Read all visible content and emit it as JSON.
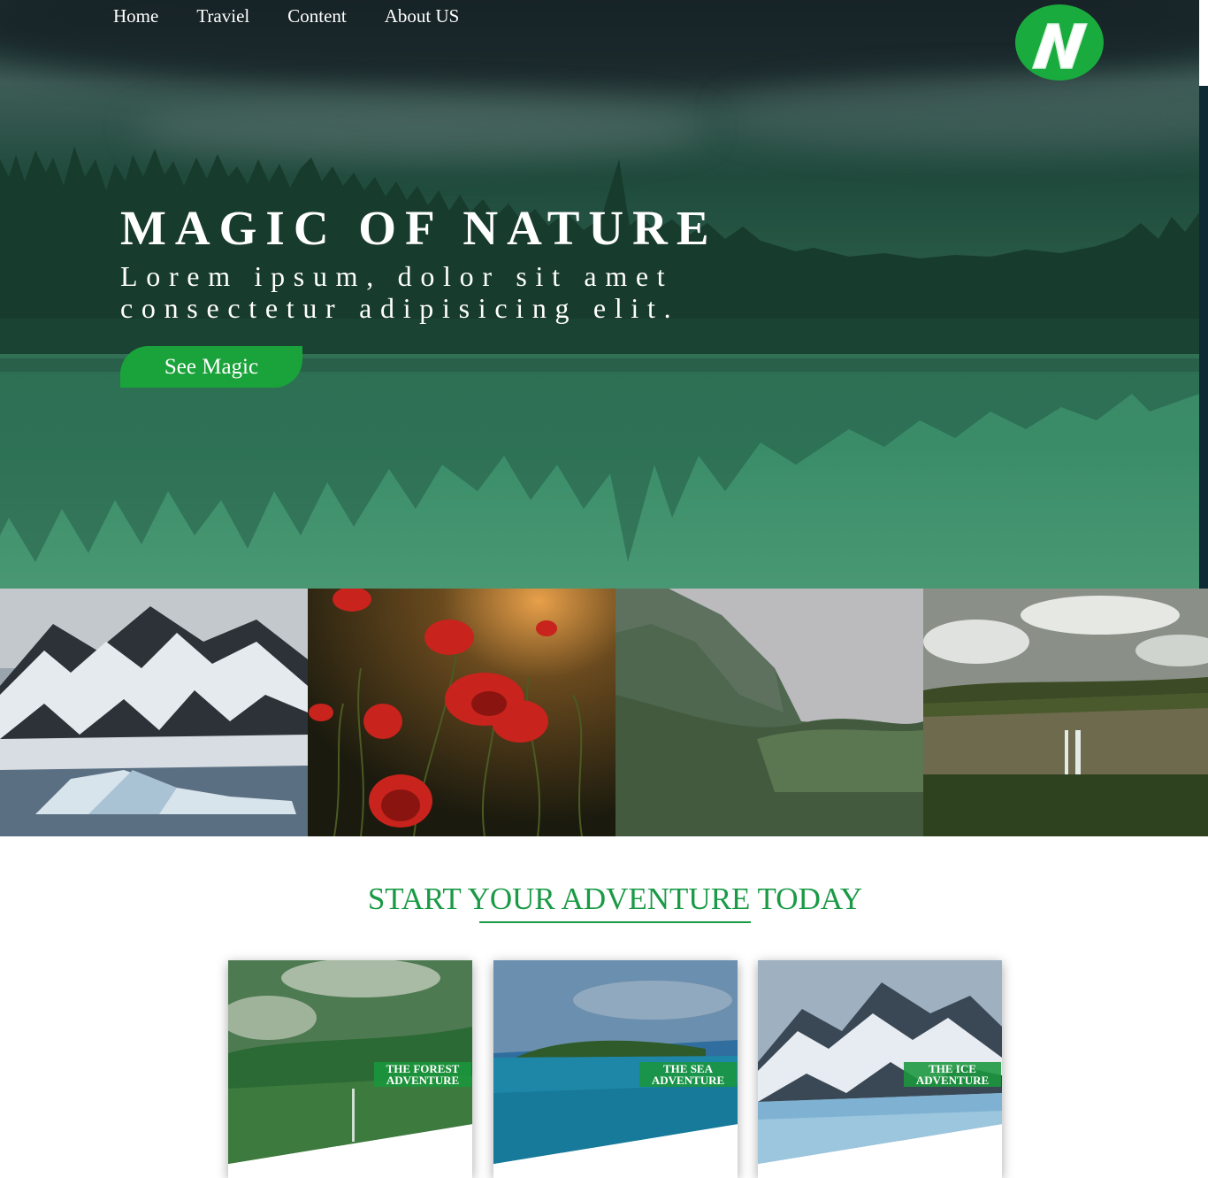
{
  "nav": {
    "items": [
      {
        "label": "Home"
      },
      {
        "label": "Traviel"
      },
      {
        "label": "Content"
      },
      {
        "label": "About US"
      }
    ],
    "logo_letter": "N"
  },
  "hero": {
    "title": "MAGIC OF NATURE",
    "subtitle_line1": "Lorem ipsum, dolor sit amet",
    "subtitle_line2": "consectetur adipisicing elit.",
    "cta_label": "See Magic"
  },
  "gallery": {
    "items": [
      {
        "icon": "snowy-mountains-image"
      },
      {
        "icon": "red-poppies-image"
      },
      {
        "icon": "misty-valley-image"
      },
      {
        "icon": "waterfall-cliff-image"
      }
    ]
  },
  "section": {
    "title": "START YOUR ADVENTURE TODAY"
  },
  "cards": [
    {
      "label_line1": "THE FOREST",
      "label_line2": "ADVENTURE"
    },
    {
      "label_line1": "THE SEA",
      "label_line2": "ADVENTURE"
    },
    {
      "label_line1": "THE ICE",
      "label_line2": "ADVENTURE"
    }
  ],
  "colors": {
    "brand_green": "#1aab3e",
    "title_green": "#1a9a45",
    "hero_overlay": "#2f7a5d"
  }
}
